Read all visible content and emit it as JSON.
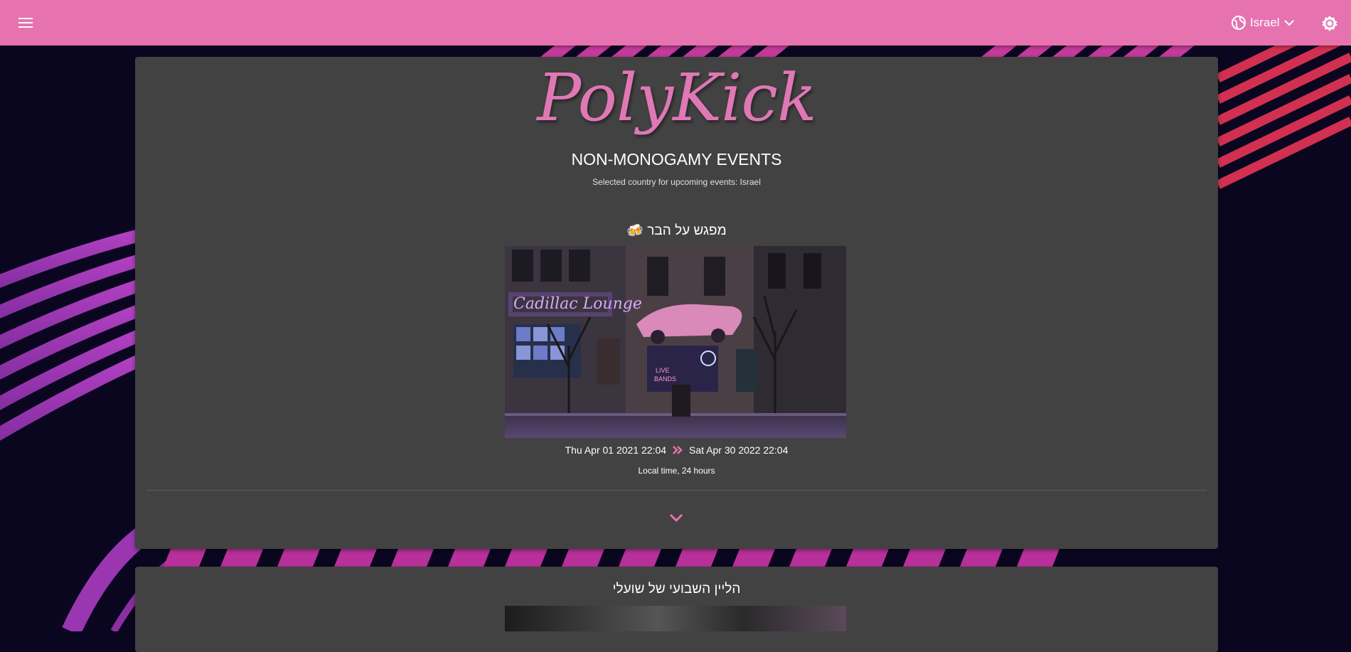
{
  "header": {
    "menu_icon": "hamburger-menu-icon",
    "country_label": "Israel",
    "globe_icon": "globe-icon",
    "chevron_icon": "chevron-down-icon",
    "theme_icon": "brightness-gear-icon"
  },
  "hero": {
    "logo_text": "PolyKick",
    "subtitle": "NON-MONOGAMY EVENTS",
    "country_note": "Selected country for upcoming events: Israel"
  },
  "events": [
    {
      "title": "מפגש על הבר 🍻",
      "start": "Thu Apr 01 2021 22:04",
      "end": "Sat Apr 30 2022 22:04",
      "time_note": "Local time, 24 hours",
      "image_name": "bar-street-night-photo",
      "image_text": [
        "Cadillac Lounge",
        "LIVE",
        "BANDS"
      ]
    },
    {
      "title": "הליין השבועי של שועלי"
    }
  ],
  "colors": {
    "accent": "#e672b0",
    "card": "#424242",
    "background": "#0b0620"
  }
}
